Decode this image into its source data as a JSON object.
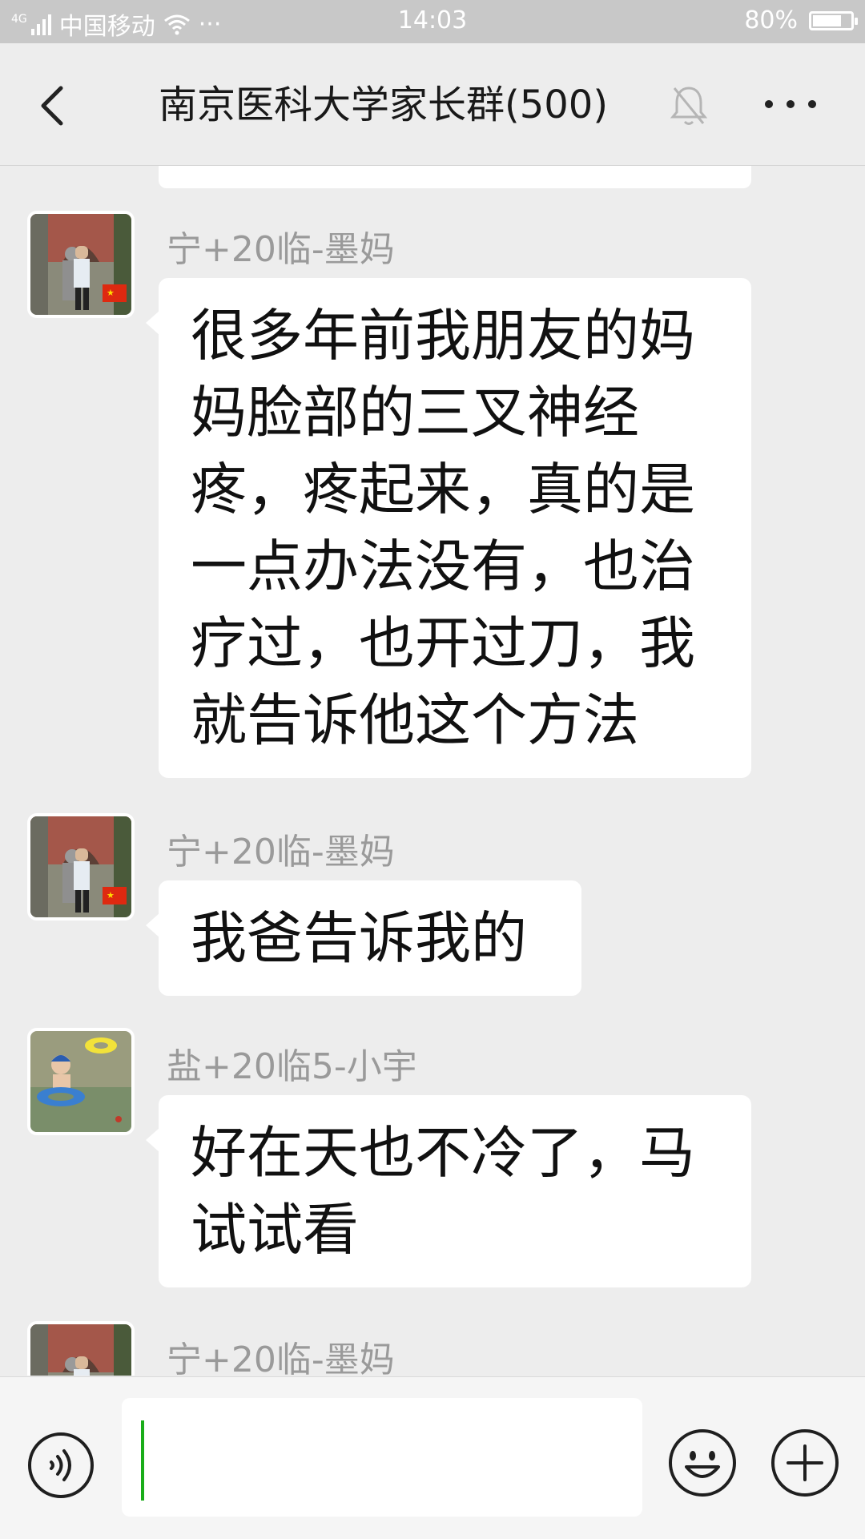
{
  "status_bar": {
    "network": "4G",
    "carrier": "中国移动",
    "dots": "···",
    "time": "14:03",
    "battery": "80%",
    "battery_level": 0.8
  },
  "header": {
    "title": "南京医科大学家长群(500)",
    "back_icon": "chevron-left-icon",
    "mute_icon": "bell-muted-icon",
    "more_icon": "more-dots-icon"
  },
  "messages": [
    {
      "sender": "宁+20临-墨妈",
      "text": "很多年前我朋友的妈妈脸部的三叉神经疼，疼起来，真的是一点办法没有，也治疗过，也开过刀，我就告诉他这个方法"
    },
    {
      "sender": "宁+20临-墨妈",
      "text": "我爸告诉我的"
    },
    {
      "sender": "盐+20临5-小宇",
      "text": "好在天也不冷了，马试试看"
    },
    {
      "sender": "宁+20临-墨妈",
      "text": ""
    }
  ],
  "input_bar": {
    "value": "",
    "voice_icon": "voice-icon",
    "emoji_icon": "emoji-icon",
    "plus_icon": "plus-icon"
  },
  "colors": {
    "background": "#ededed",
    "bubble": "#ffffff",
    "sender": "#9a9a9a",
    "status_bar": "#c8c8c8",
    "cursor": "#1aad19"
  }
}
